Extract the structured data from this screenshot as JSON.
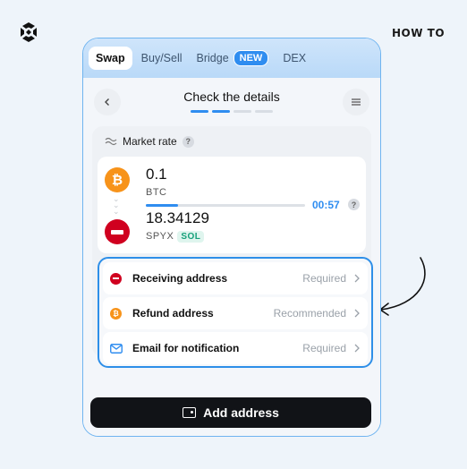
{
  "top": {
    "howto": "HOW TO"
  },
  "tabs": [
    {
      "label": "Swap",
      "active": true
    },
    {
      "label": "Buy/Sell",
      "active": false
    },
    {
      "label": "Bridge",
      "active": false,
      "badge": "NEW"
    },
    {
      "label": "DEX",
      "active": false
    }
  ],
  "header": {
    "title": "Check the details",
    "steps_total": 4,
    "steps_done": 2
  },
  "rate": {
    "label": "Market rate",
    "help": "?"
  },
  "swap": {
    "from": {
      "amount": "0.1",
      "symbol": "BTC"
    },
    "to": {
      "amount": "18.34129",
      "symbol": "SPYX",
      "network": "SOL"
    },
    "timer": "00:57",
    "timer_help": "?",
    "timer_progress_fraction": 0.2
  },
  "addresses": [
    {
      "label": "Receiving address",
      "status": "Required"
    },
    {
      "label": "Refund address",
      "status": "Recommended"
    },
    {
      "label": "Email for notification",
      "status": "Required"
    }
  ],
  "cta": {
    "label": "Add address"
  },
  "colors": {
    "accent": "#2f8df0",
    "btc": "#f7931a",
    "spyx": "#d0001f",
    "sol": "#16a07a"
  }
}
